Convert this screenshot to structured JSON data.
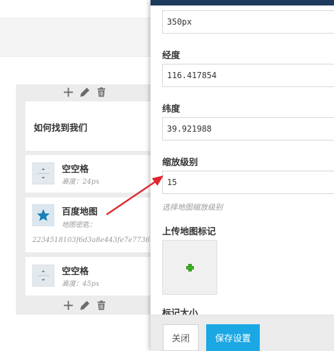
{
  "builder": {
    "heading": "如何找到我们",
    "items": [
      {
        "title": "空空格",
        "sub": "高度：24px"
      },
      {
        "title": "百度地图",
        "sub": "地图密匙：",
        "key": "2234518103f6d3a8e443fe7e7736"
      },
      {
        "title": "空空格",
        "sub": "高度：45px"
      }
    ]
  },
  "panel": {
    "height_value": "350px",
    "longitude_label": "经度",
    "longitude_value": "116.417854",
    "latitude_label": "纬度",
    "latitude_value": "39.921988",
    "zoom_label": "缩放级别",
    "zoom_value": "15",
    "zoom_hint": "选择地图缩放级别",
    "upload_label": "上传地图标记",
    "marker_size_label": "标记大小"
  },
  "footer": {
    "close_label": "关闭",
    "save_label": "保存设置"
  },
  "colors": {
    "panel_header": "#1e3a5c",
    "save_button": "#1aa7e4",
    "arrow": "#e0262f",
    "plus": "#3dbb1e"
  }
}
